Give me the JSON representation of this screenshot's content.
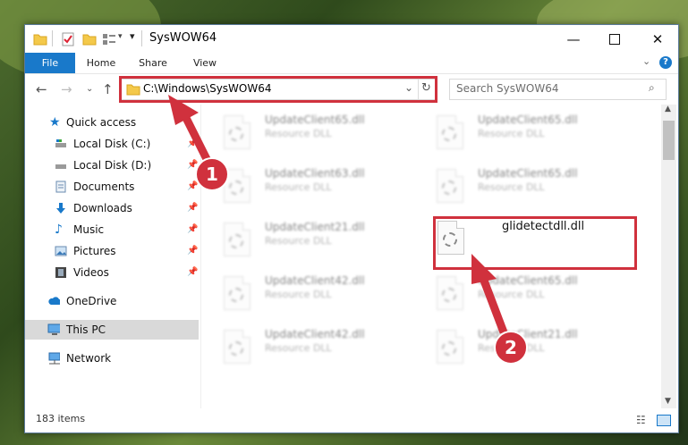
{
  "window": {
    "title": "SysWOW64"
  },
  "ribbon": {
    "tabs": [
      "File",
      "Home",
      "Share",
      "View"
    ]
  },
  "address": {
    "path": "C:\\Windows\\SysWOW64"
  },
  "search": {
    "placeholder": "Search SysWOW64"
  },
  "nav": {
    "items": [
      {
        "label": "Quick access",
        "icon": "star-icon"
      },
      {
        "label": "Local Disk (C:)",
        "icon": "drive-icon"
      },
      {
        "label": "Local Disk (D:)",
        "icon": "drive-icon"
      },
      {
        "label": "Documents",
        "icon": "documents-icon"
      },
      {
        "label": "Downloads",
        "icon": "download-icon"
      },
      {
        "label": "Music",
        "icon": "music-icon"
      },
      {
        "label": "Pictures",
        "icon": "pictures-icon"
      },
      {
        "label": "Videos",
        "icon": "videos-icon"
      },
      {
        "label": "OneDrive",
        "icon": "cloud-icon"
      },
      {
        "label": "This PC",
        "icon": "computer-icon"
      },
      {
        "label": "Network",
        "icon": "network-icon"
      }
    ]
  },
  "files": [
    {
      "name": "UpdateClient65.dll",
      "desc": "Resource DLL"
    },
    {
      "name": "UpdateClient65.dll",
      "desc": "Resource DLL"
    },
    {
      "name": "UpdateClient63.dll",
      "desc": "Resource DLL"
    },
    {
      "name": "UpdateClient65.dll",
      "desc": "Resource DLL"
    },
    {
      "name": "UpdateClient21.dll",
      "desc": "Resource DLL"
    },
    {
      "name": "glidetectdll.dll",
      "desc": ""
    },
    {
      "name": "UpdateClient42.dll",
      "desc": "Resource DLL"
    },
    {
      "name": "UpdateClient65.dll",
      "desc": "Resource DLL"
    },
    {
      "name": "UpdateClient42.dll",
      "desc": "Resource DLL"
    },
    {
      "name": "UpdateClient21.dll",
      "desc": "Resource DLL"
    }
  ],
  "status": {
    "item_count": "183 items"
  },
  "annotations": {
    "step1": "1",
    "step2": "2"
  },
  "colors": {
    "accent": "#1979ca",
    "highlight": "#d0313d"
  }
}
